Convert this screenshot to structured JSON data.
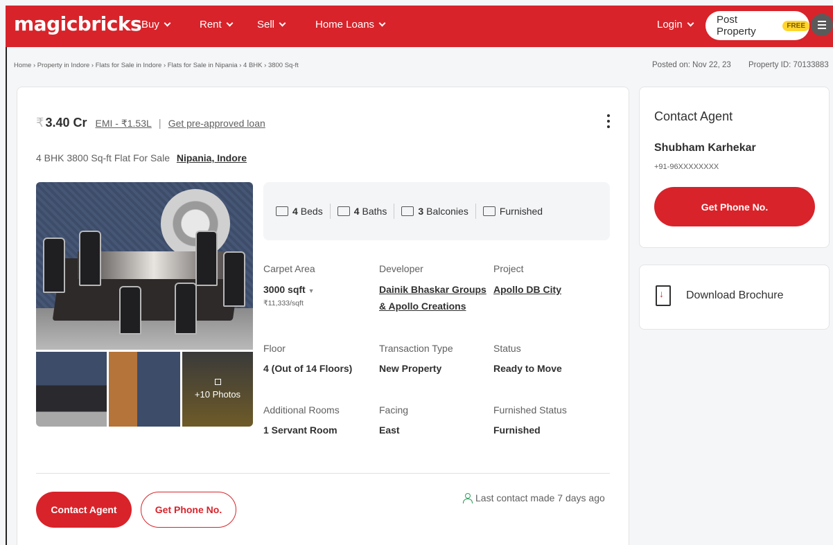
{
  "header": {
    "brand": "magicbricks",
    "nav": [
      "Buy",
      "Rent",
      "Sell",
      "Home Loans"
    ],
    "login": "Login",
    "post_property": "Post Property",
    "free_badge": "FREE"
  },
  "breadcrumb": "Home › Property in Indore › Flats for Sale in Indore › Flats for Sale in Nipania › 4 BHK › 3800 Sq-ft",
  "posted_on": "Posted on: Nov 22, 23",
  "property_id": "Property ID: 70133883",
  "listing": {
    "currency_symbol": "₹",
    "price": "3.40 Cr",
    "emi": "EMI - ₹1.53L",
    "separator": "|",
    "loan_link": "Get pre-approved loan",
    "title": "4 BHK 3800 Sq-ft Flat For Sale",
    "location": "Nipania, Indore"
  },
  "amenities": [
    {
      "count": "4",
      "label": "Beds",
      "icon": "bed-icon"
    },
    {
      "count": "4",
      "label": "Baths",
      "icon": "bath-icon"
    },
    {
      "count": "3",
      "label": "Balconies",
      "icon": "balcony-icon"
    },
    {
      "count": "",
      "label": "Furnished",
      "icon": "furniture-icon"
    }
  ],
  "details": {
    "carpet_area_label": "Carpet Area",
    "carpet_area_value": "3000 sqft",
    "price_per_sqft": "₹11,333/sqft",
    "developer_label": "Developer",
    "developer_value_line1": "Dainik Bhaskar Groups",
    "developer_value_line2": "& Apollo Creations",
    "project_label": "Project",
    "project_value": "Apollo DB City",
    "floor_label": "Floor",
    "floor_value": "4 (Out of 14 Floors)",
    "transaction_label": "Transaction Type",
    "transaction_value": "New Property",
    "status_label": "Status",
    "status_value": "Ready to Move",
    "rooms_label": "Additional Rooms",
    "rooms_value": "1 Servant Room",
    "facing_label": "Facing",
    "facing_value": "East",
    "furnished_label": "Furnished Status",
    "furnished_value": "Furnished"
  },
  "photos": {
    "more_label": "+10 Photos"
  },
  "actions": {
    "contact_agent": "Contact Agent",
    "get_phone": "Get Phone No.",
    "last_contact": "Last contact made 7 days ago"
  },
  "agent": {
    "heading": "Contact Agent",
    "name": "Shubham Karhekar",
    "phone": "+91-96XXXXXXXX",
    "button": "Get Phone No."
  },
  "brochure": {
    "label": "Download Brochure"
  },
  "colors": {
    "brand_red": "#d8232a",
    "free_badge": "#ffd52e",
    "contact_icon": "#2c9f5a"
  }
}
